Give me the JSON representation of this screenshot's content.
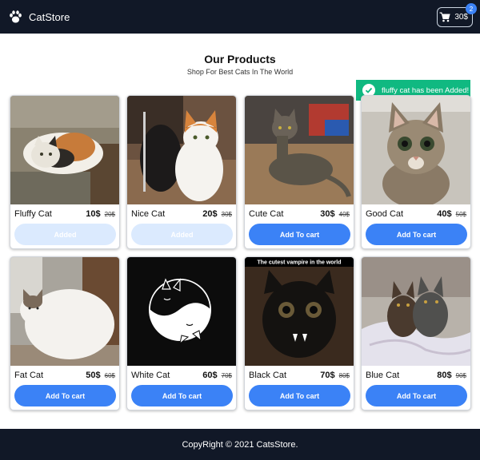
{
  "navbar": {
    "brand": "CatStore",
    "brand_icon": "paw-icon",
    "cart": {
      "total": "30$",
      "count": "2",
      "icon": "cart-icon"
    }
  },
  "heading": {
    "title": "Our Products",
    "subtitle": "Shop For Best Cats In The World"
  },
  "toast": {
    "message": "fluffy cat has been Added!",
    "icon": "check-icon",
    "color": "#10b981"
  },
  "products": [
    {
      "name": "Fluffy Cat",
      "price": "10$",
      "old_price": "20$",
      "button": "Added",
      "added": true
    },
    {
      "name": "Nice Cat",
      "price": "20$",
      "old_price": "30$",
      "button": "Added",
      "added": true
    },
    {
      "name": "Cute Cat",
      "price": "30$",
      "old_price": "40$",
      "button": "Add To cart",
      "added": false
    },
    {
      "name": "Good Cat",
      "price": "40$",
      "old_price": "50$",
      "button": "Add To cart",
      "added": false
    },
    {
      "name": "Fat Cat",
      "price": "50$",
      "old_price": "60$",
      "button": "Add To cart",
      "added": false
    },
    {
      "name": "White Cat",
      "price": "60$",
      "old_price": "70$",
      "button": "Add To cart",
      "added": false
    },
    {
      "name": "Black Cat",
      "price": "70$",
      "old_price": "80$",
      "button": "Add To cart",
      "added": false,
      "image_caption": "The cutest vampire in the world"
    },
    {
      "name": "Blue Cat",
      "price": "80$",
      "old_price": "90$",
      "button": "Add To cart",
      "added": false
    }
  ],
  "footer": {
    "text": "CopyRight © 2021 CatsStore."
  },
  "colors": {
    "nav": "#111827",
    "primary": "#3b82f6",
    "added": "#dbeafe",
    "toast": "#10b981"
  }
}
